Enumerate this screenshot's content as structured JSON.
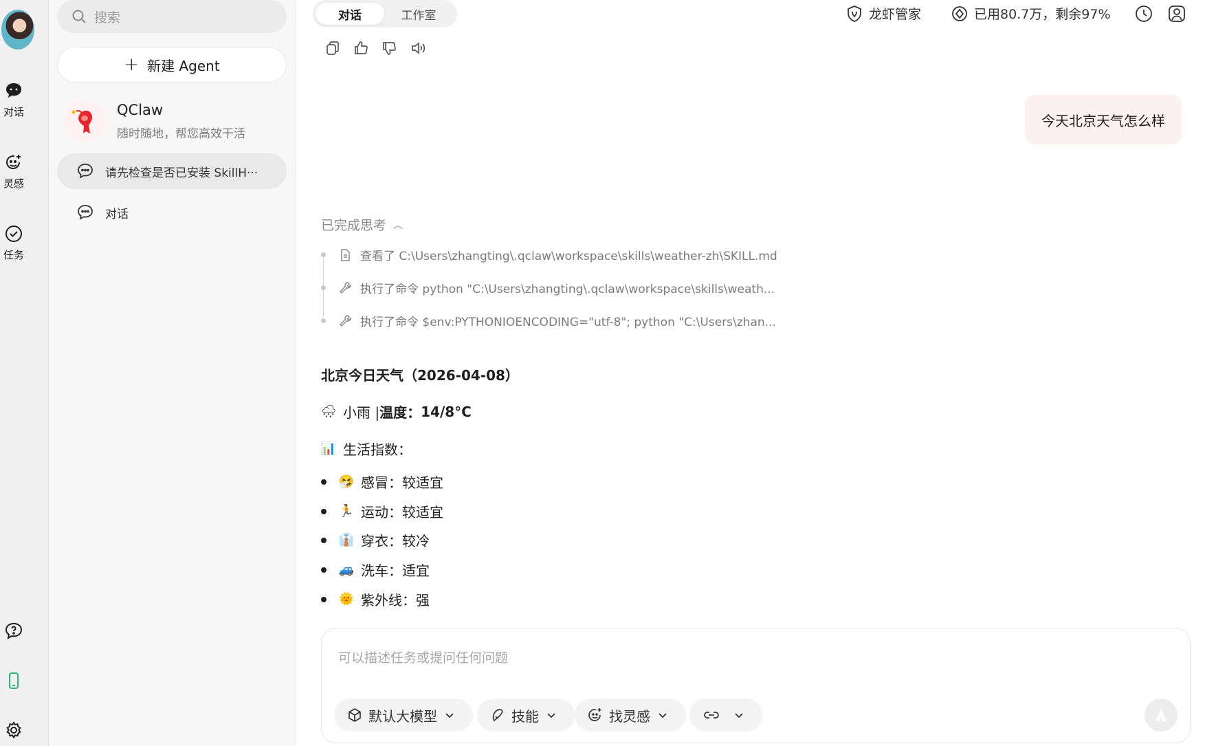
{
  "rail": {
    "items": [
      {
        "label": "对话",
        "icon": "chat-icon"
      },
      {
        "label": "灵感",
        "icon": "inspiration-icon"
      },
      {
        "label": "任务",
        "icon": "task-icon"
      }
    ],
    "bottom_icons": [
      "help-icon",
      "phone-icon",
      "gear-icon"
    ]
  },
  "sidebar": {
    "search_placeholder": "搜索",
    "new_agent_label": "新建 Agent",
    "agent": {
      "name": "QClaw",
      "subtitle": "随时随地，帮您高效干活"
    },
    "conversations": [
      {
        "title": "请先检查是否已安装 SkillH···",
        "active": true
      },
      {
        "title": "对话",
        "active": false
      }
    ]
  },
  "header": {
    "tabs": [
      {
        "label": "对话",
        "active": true
      },
      {
        "label": "工作室",
        "active": false
      }
    ],
    "manager_label": "龙虾管家",
    "usage_label": "已用80.7万，剩余97%"
  },
  "chat": {
    "user_message": "今天北京天气怎么样",
    "thinking_label": "已完成思考",
    "steps": [
      {
        "icon": "document-icon",
        "text": "查看了 C:\\Users\\zhangting\\.qclaw\\workspace\\skills\\weather-zh\\SKILL.md"
      },
      {
        "icon": "wrench-icon",
        "text": "执行了命令 python \"C:\\Users\\zhangting\\.qclaw\\workspace\\skills\\weath..."
      },
      {
        "icon": "wrench-icon",
        "text": "执行了命令 $env:PYTHONIOENCODING=\"utf-8\"; python \"C:\\Users\\zhan..."
      }
    ],
    "answer": {
      "title": "北京今日天气（2026-04-08）",
      "weather_emoji": "🌧",
      "weather_desc": "小雨 | ",
      "temp_label": "温度：",
      "temp_value": "14/8°C",
      "index_emoji": "📊",
      "index_label": "生活指数：",
      "items": [
        {
          "emoji": "🤧",
          "text": "感冒：较适宜"
        },
        {
          "emoji": "🏃",
          "text": "运动：较适宜"
        },
        {
          "emoji": "👔",
          "text": "穿衣：较冷"
        },
        {
          "emoji": "🚙",
          "text": "洗车：适宜"
        },
        {
          "emoji": "🌞",
          "text": "紫外线：强"
        }
      ]
    }
  },
  "composer": {
    "placeholder": "可以描述任务或提问任何问题",
    "chips": [
      {
        "label": "默认大模型",
        "icon": "cube-icon"
      },
      {
        "label": "技能",
        "icon": "skill-icon"
      },
      {
        "label": "找灵感",
        "icon": "inspiration-icon"
      },
      {
        "label": "",
        "icon": "link-icon"
      }
    ]
  },
  "colors": {
    "accent_bubble": "#fdf0f0",
    "phone_icon": "#2bb673"
  }
}
